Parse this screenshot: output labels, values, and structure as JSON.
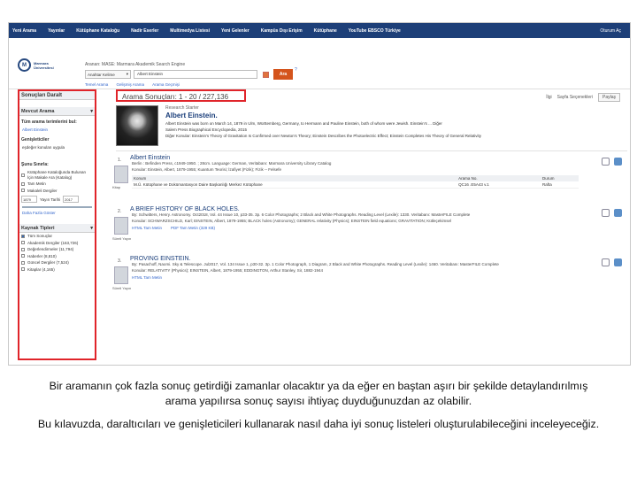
{
  "topnav": {
    "items": [
      "Yeni Arama",
      "Yayınlar",
      "Kütüphane Kataloğu",
      "Nadir Eserler",
      "Multimedya Listesi",
      "Yeni Gelenler",
      "Kampüs Dışı Erişim",
      "Kütüphane",
      "YouTube EBSCO Türkiye"
    ],
    "signin": "Oturum Aç"
  },
  "logo": {
    "text_line1": "Marmara",
    "text_line2": "Üniversitesi"
  },
  "search": {
    "db_line": "Aranan: MASE: Marmara Akademik Search Engine",
    "field_select": "Anahtar Kelime",
    "value": "Albert Einstein",
    "button": "Ara",
    "help": "?",
    "links": [
      "Temel Arama",
      "Gelişmiş Arama",
      "Arama Geçmişi"
    ]
  },
  "facets": {
    "title": "Sonuçları Daralt",
    "current_search_title": "Mevcut Arama",
    "all_terms_label": "Tüm arama terimlerini bul:",
    "all_terms_value": "Albert Einstein",
    "expanders_label": "Genişleticiler",
    "expander_value": "eşdeğer konuları uygula",
    "limit_title": "Şunu Sınırla:",
    "limits": [
      "Kütüphane Kataloğunda Bulunan İçin Makale Ara (Katalog)",
      "Tam Metin",
      "Makaleli Dergiler"
    ],
    "year_from": "1879",
    "year_label": "Yayın Tarihi",
    "year_to": "2017",
    "show_more": "Daha Fazla Göster",
    "source_title": "Kaynak Tipleri",
    "sources": [
      "Tüm Sonuçlar",
      "Akademik Dergiler (163,726)",
      "Değerlendirmeler (11,794)",
      "Haberler (8,810)",
      "Güncel Dergiler (7,524)",
      "Kitaplar (4,165)"
    ]
  },
  "results": {
    "count_label": "Arama Sonuçları: 1 - 20 / 227,136",
    "sort_label": "İlgi",
    "page_options": "Sayfa Seçenekleri",
    "share": "Paylaş"
  },
  "research": {
    "tag": "Research Starter",
    "title": "Albert Einstein.",
    "lines": [
      "Albert Einstein was born on March 14, 1879 in Ulm, Württemberg, Germany, to Hermann and Pauline Einstein, both of whom were Jewish. Einstein's ... Diğer",
      "Salem Press Biographical Encyclopedia, 2015",
      "Diğer Konular: Einstein's Theory of Gravitation Is Confirmed over Newton's Theory; Einstein Describes the Photoelectric Effect; Einstein Completes His Theory of General Relativity"
    ]
  },
  "records": [
    {
      "num": "1.",
      "title": "Albert Einstein",
      "meta": [
        "Berlin : Befinden Press, c1949-1950. ; 28cm. Language: German, Veritabanı: Marmara University Library Catalog",
        "Konular: Einstein, Albert, 1879-1955; Kuantum Teorisi; İzafiyet (Fizik); Fizik -- Felsefe"
      ],
      "thumb_label": "Kitap",
      "holdings_header": [
        "Konum",
        "Arama No.",
        "Durum"
      ],
      "holdings_row": [
        "M.Ü. Kütüphane ve Dokümantasyon Daire Başkanlığı Merkez Kütüphane",
        "QC16 .E5A43 v.1",
        "Rafta"
      ]
    },
    {
      "num": "2.",
      "title": "A BRIEF HISTORY OF BLACK HOLES.",
      "meta": [
        "By: Schwitters, Henry. Astronomy. Oct2018, Vol. 44 Issue 10, p33-35. 3p. 6 Color Photographs; 2 Black and White Photographs. Reading Level (Lexile): 1330. Veritabanı: MasterFILE Complete",
        "Konular: SCHWARZSCHILD, Karl; EINSTEIN, Albert, 1879-1955; BLACK holes (Astronomy); GENERAL relativity (Physics); EINSTEIN field equations; GRAVITATION; Kütleçekimsel"
      ],
      "thumb_label": "Süreli Yayın",
      "fulltext": [
        "HTML Tam Metin",
        "PDF Tam Metin (329 KB)"
      ]
    },
    {
      "num": "3.",
      "title": "PROVING EINSTEIN.",
      "meta": [
        "By: Pasachoff, Naomi. Sky & Telescope. Jul2017, Vol. 134 Issue 1, p30-32. 3p. 1 Color Photograph, 1 Diagram, 2 Black and White Photographs. Reading Level (Lexile): 1460. Veritabanı: MasterFILE Complete",
        "Konular: RELATIVITY (Physics); EINSTEIN, Albert, 1879-1955; EDDINGTON, Arthur Stanley, Sir, 1882-1944"
      ],
      "thumb_label": "Süreli Yayın",
      "fulltext": [
        "HTML Tam Metin"
      ]
    }
  ],
  "captions": [
    "Bir aramanın çok fazla sonuç getirdiği zamanlar olacaktır ya da eğer en baştan aşırı bir şekilde detaylandırılmış arama yapılırsa sonuç sayısı ihtiyaç duyduğunuzdan az olabilir.",
    "Bu kılavuzda, daraltıcıları ve genişleticileri kullanarak nasıl daha iyi sonuç listeleri oluşturulabileceğini inceleyeceğiz."
  ],
  "colors": {
    "nav": "#1d3f78",
    "highlight": "#e0242a",
    "search_button": "#d4541c",
    "link": "#3366cc"
  }
}
